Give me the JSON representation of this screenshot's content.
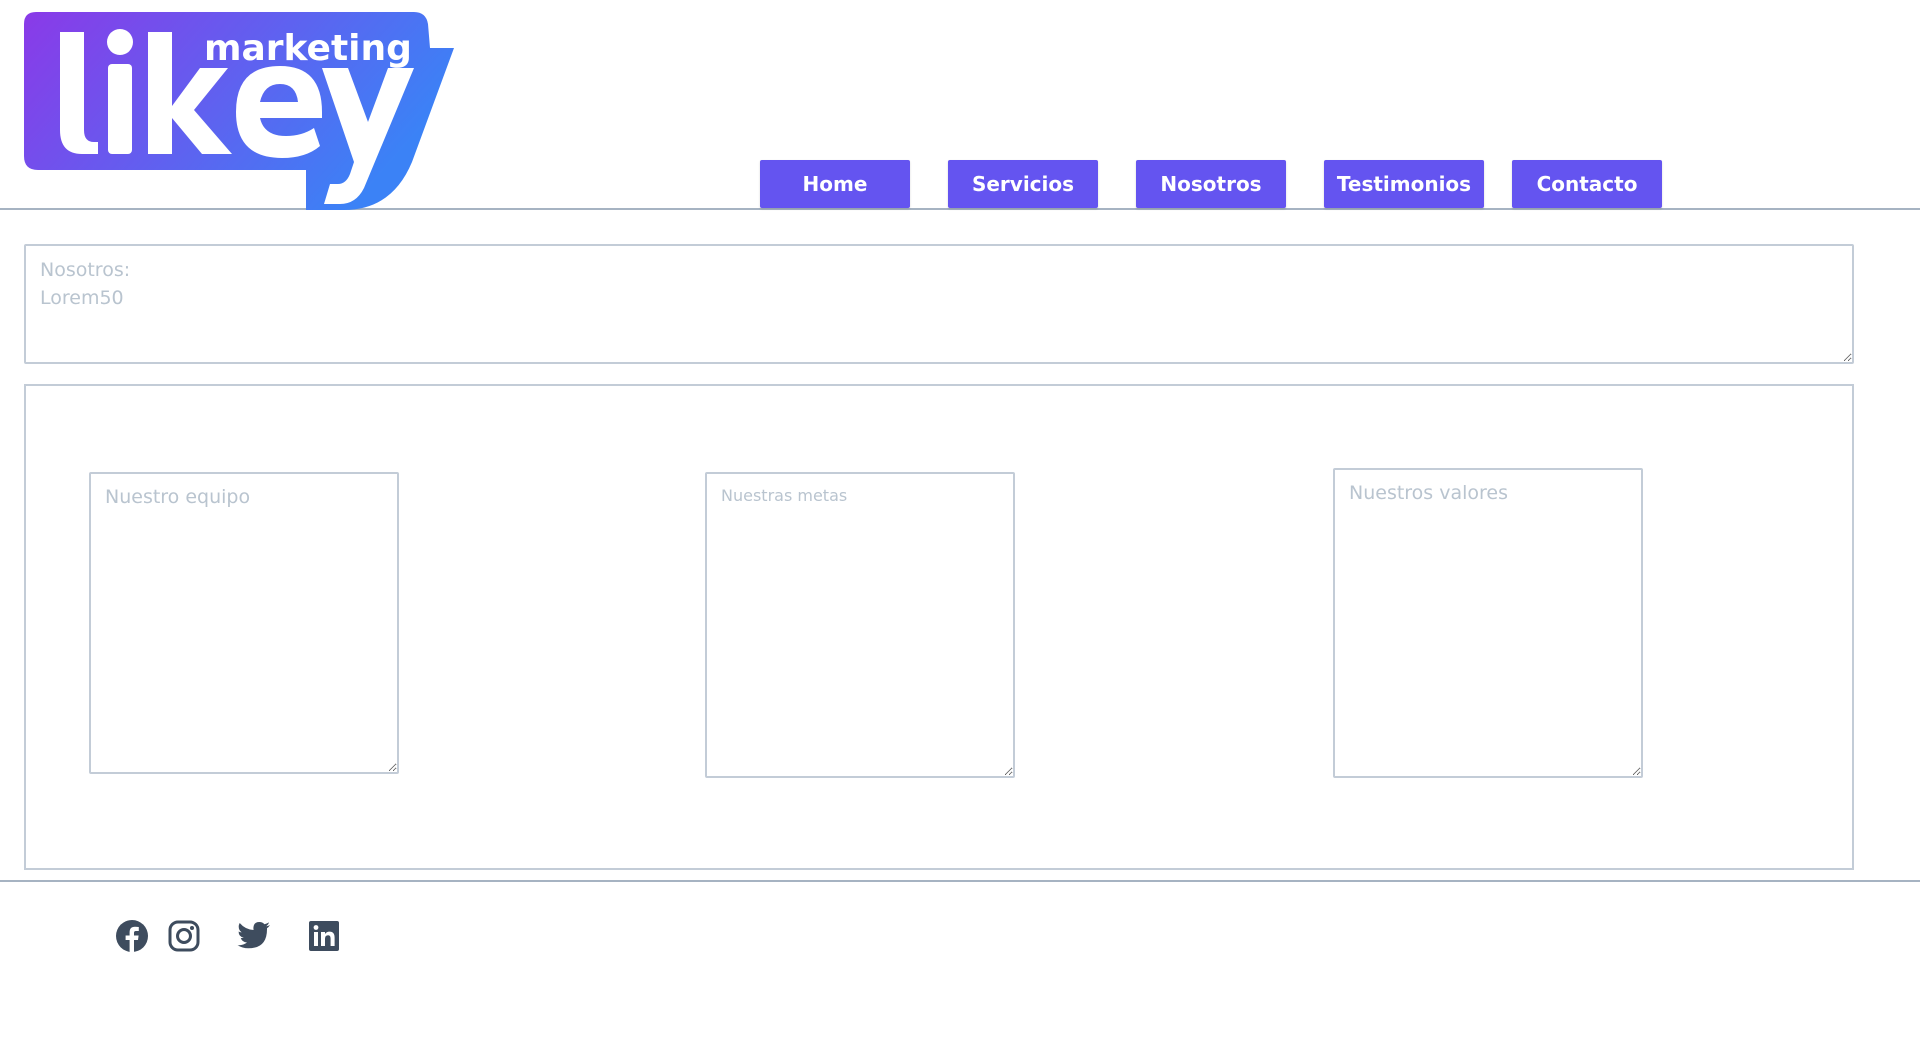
{
  "header": {
    "logo": {
      "brand_text": "likey",
      "tag_text": "marketing"
    },
    "nav": [
      {
        "label": "Home"
      },
      {
        "label": "Servicios"
      },
      {
        "label": "Nosotros"
      },
      {
        "label": "Testimonios"
      },
      {
        "label": "Contacto"
      }
    ]
  },
  "about": {
    "placeholder": "Nosotros:\nLorem50"
  },
  "cards": [
    {
      "placeholder": "Nuestro equipo"
    },
    {
      "placeholder": "Nuestras metas"
    },
    {
      "placeholder": "Nuestros valores"
    }
  ],
  "footer": {
    "social": [
      {
        "icon": "facebook-icon"
      },
      {
        "icon": "instagram-icon"
      },
      {
        "icon": "twitter-icon"
      },
      {
        "icon": "linkedin-icon"
      }
    ]
  },
  "colors": {
    "nav_button": "#6454f0",
    "logo_gradient_start": "#8a3ae8",
    "logo_gradient_end": "#3b82f6",
    "border": "#c3ccd7",
    "placeholder": "#b9c4cf",
    "icon": "#3e4c5e"
  }
}
